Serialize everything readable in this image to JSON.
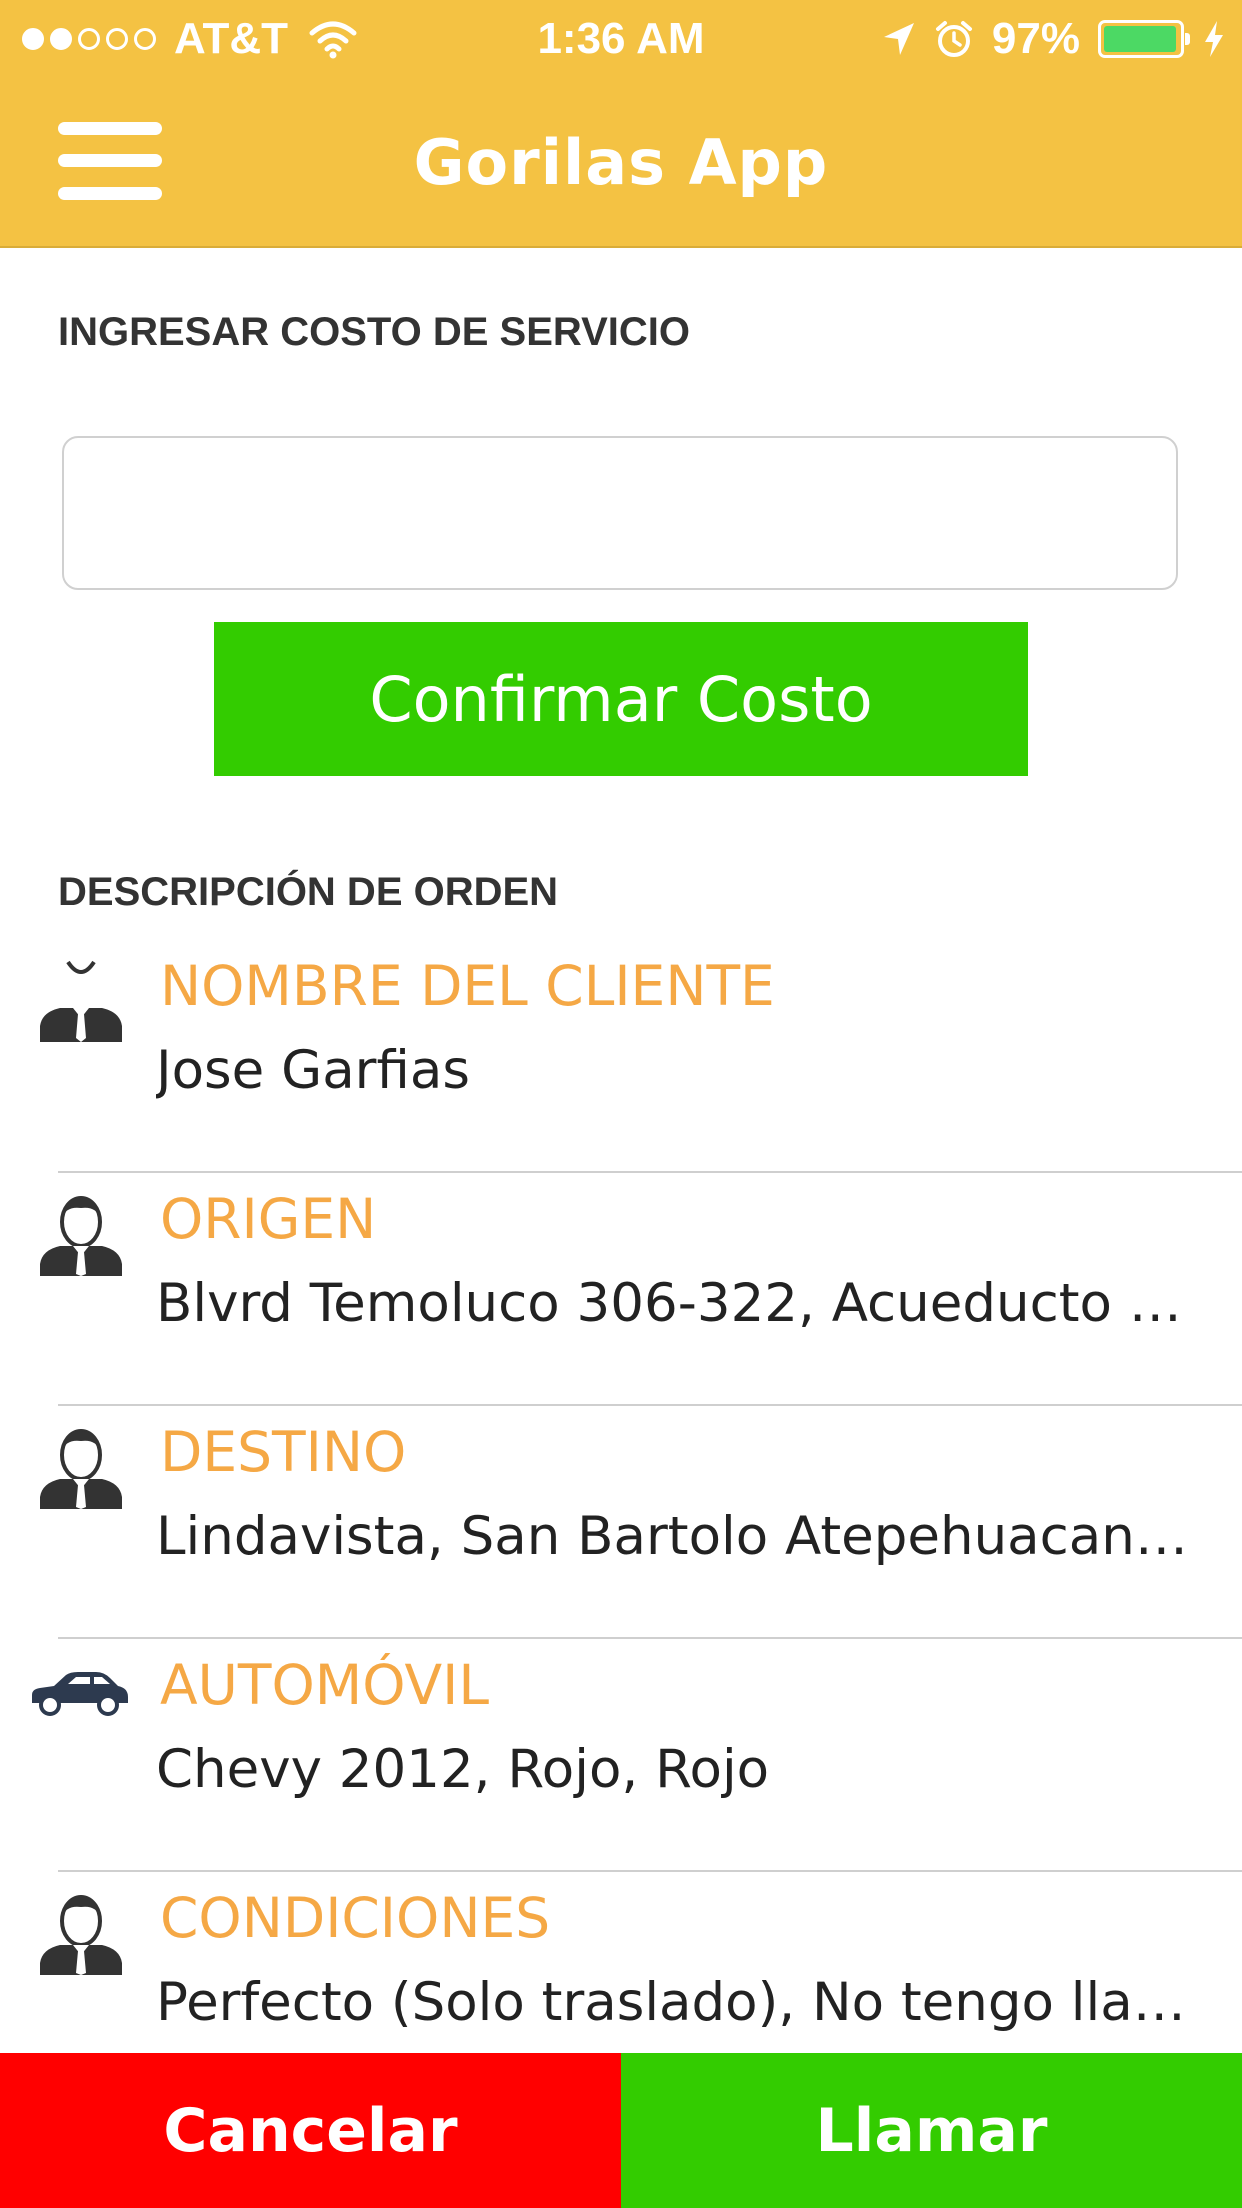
{
  "status_bar": {
    "carrier": "AT&T",
    "time": "1:36 AM",
    "battery": "97%",
    "battery_level": 0.97,
    "signal_bars_filled": 2,
    "signal_bars_total": 5
  },
  "header": {
    "title": "Gorilas App",
    "menu_icon": "hamburger-menu-icon"
  },
  "cost_section": {
    "label": "INGRESAR COSTO DE SERVICIO",
    "input_value": "",
    "input_placeholder": "",
    "confirm_label": "Confirmar Costo"
  },
  "order": {
    "label": "DESCRIPCIÓN DE ORDEN",
    "items": [
      {
        "title": "NOMBRE DEL CLIENTE",
        "value": "Jose Garfias",
        "icon": "person-icon"
      },
      {
        "title": "ORIGEN",
        "value": "Blvrd Temoluco 306-322, Acueducto de...",
        "icon": "person-icon"
      },
      {
        "title": "DESTINO",
        "value": "Lindavista, San Bartolo Atepehuacan, C...",
        "icon": "person-icon"
      },
      {
        "title": "AUTOMÓVIL",
        "value": "Chevy 2012, Rojo, Rojo",
        "icon": "car-icon"
      },
      {
        "title": "CONDICIONES",
        "value": "Perfecto (Solo traslado), No tengo llave...",
        "icon": "person-icon"
      }
    ]
  },
  "actions": {
    "cancel_label": "Cancelar",
    "call_label": "Llamar"
  },
  "colors": {
    "header": "#F4C243",
    "accent_title": "#F5A845",
    "confirm": "#33CC00",
    "cancel": "#FF0000",
    "call": "#33CC00"
  }
}
